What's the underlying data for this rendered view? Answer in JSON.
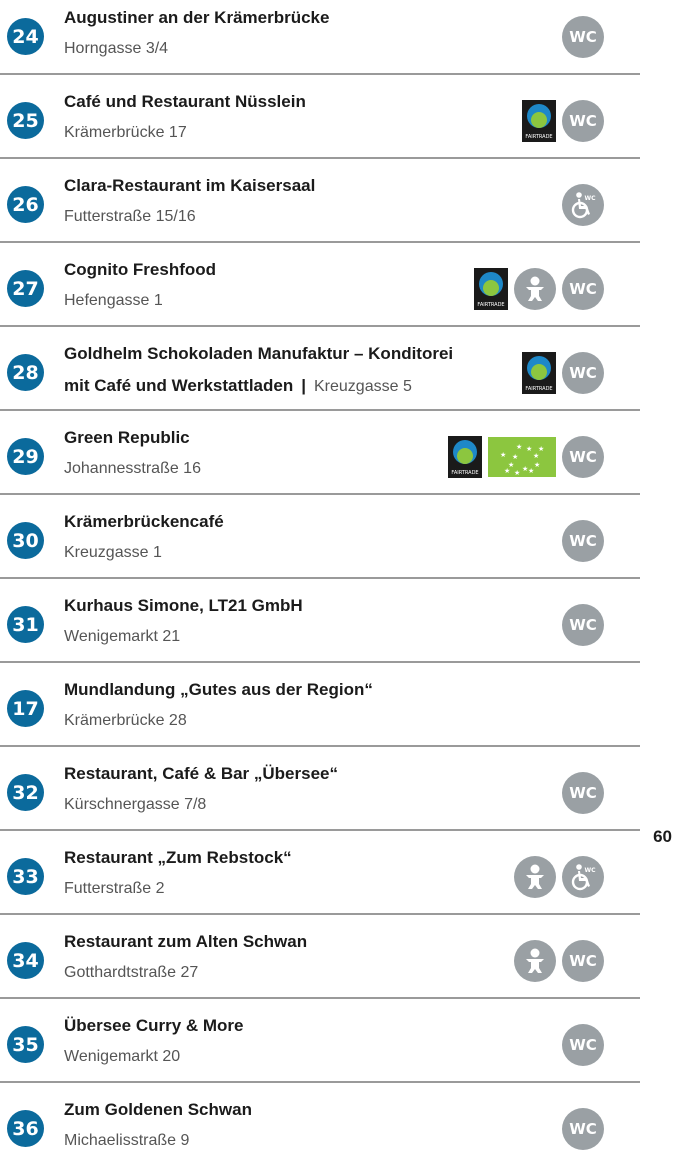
{
  "page_number": "60",
  "icons": {
    "wc": "WC",
    "fairtrade_label": "FAIRTRADE"
  },
  "colors": {
    "number_badge": "#0b6a9c",
    "icon_gray": "#9aa0a4",
    "eu_organic": "#8cc63f"
  },
  "entries": [
    {
      "num": "24",
      "name": "Augustiner an der Krämerbrücke",
      "addr": "Horngasse 3/4",
      "icons": [
        "wc-icon"
      ]
    },
    {
      "num": "25",
      "name": "Café und Restaurant Nüsslein",
      "addr": "Krämerbrücke 17",
      "icons": [
        "fairtrade-logo",
        "wc-icon"
      ]
    },
    {
      "num": "26",
      "name": "Clara-Restaurant im Kaisersaal",
      "addr": "Futterstraße 15/16",
      "icons": [
        "wheelchair-wc-icon"
      ]
    },
    {
      "num": "27",
      "name": "Cognito Freshfood",
      "addr": "Hefengasse 1",
      "icons": [
        "fairtrade-logo",
        "baby-changing-icon",
        "wc-icon"
      ]
    },
    {
      "num": "28",
      "name": "Goldhelm Schokoladen Manufaktur – Konditorei",
      "name2": "mit Café und Werkstattladen",
      "sep": "|",
      "addr": "Kreuzgasse 5",
      "icons": [
        "fairtrade-logo",
        "wc-icon"
      ]
    },
    {
      "num": "29",
      "name": "Green Republic",
      "addr": "Johannesstraße 16",
      "icons": [
        "fairtrade-logo",
        "eu-organic-logo",
        "wc-icon"
      ]
    },
    {
      "num": "30",
      "name": "Krämerbrückencafé",
      "addr": "Kreuzgasse 1",
      "icons": [
        "wc-icon"
      ]
    },
    {
      "num": "31",
      "name": "Kurhaus Simone, LT21 GmbH",
      "addr": "Wenigemarkt 21",
      "icons": [
        "wc-icon"
      ]
    },
    {
      "num": "17",
      "name": "Mundlandung „Gutes aus der Region“",
      "addr": "Krämerbrücke 28",
      "icons": []
    },
    {
      "num": "32",
      "name": "Restaurant, Café & Bar „Übersee“",
      "addr": "Kürschnergasse 7/8",
      "icons": [
        "wc-icon"
      ]
    },
    {
      "num": "33",
      "name": "Restaurant „Zum Rebstock“",
      "addr": "Futterstraße 2",
      "icons": [
        "baby-changing-icon",
        "wheelchair-wc-icon"
      ]
    },
    {
      "num": "34",
      "name": "Restaurant zum Alten Schwan",
      "addr": "Gotthardtstraße 27",
      "icons": [
        "baby-changing-icon",
        "wc-icon"
      ]
    },
    {
      "num": "35",
      "name": "Übersee Curry & More",
      "addr": "Wenigemarkt 20",
      "icons": [
        "wc-icon"
      ]
    },
    {
      "num": "36",
      "name": "Zum Goldenen Schwan",
      "addr": "Michaelisstraße 9",
      "icons": [
        "wc-icon"
      ]
    }
  ]
}
